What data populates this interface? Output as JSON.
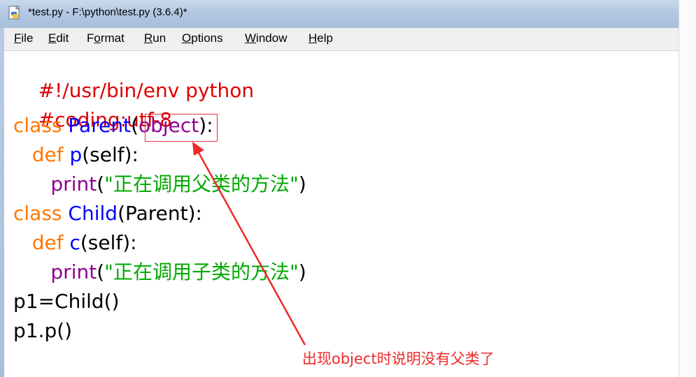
{
  "window": {
    "title": "*test.py - F:\\python\\test.py (3.6.4)*",
    "icon": "python-file-icon"
  },
  "menu": [
    {
      "accel": "F",
      "rest": "ile"
    },
    {
      "accel": "E",
      "rest": "dit"
    },
    {
      "pre": "F",
      "accel": "o",
      "rest": "rmat"
    },
    {
      "accel": "R",
      "rest": "un"
    },
    {
      "accel": "O",
      "rest": "ptions"
    },
    {
      "accel": "W",
      "rest": "indow"
    },
    {
      "accel": "H",
      "rest": "elp"
    }
  ],
  "code": {
    "line1": {
      "comment": "#!/usr/bin/env python"
    },
    "line2": {
      "comment": "#coding:utf-8"
    },
    "line3": {
      "kw": "class",
      "sp": " ",
      "name": "Parent",
      "open": "(",
      "base": "object",
      "close": "):"
    },
    "line4": {
      "indent": "   ",
      "kw": "def",
      "sp": " ",
      "name": "p",
      "args": "(self):"
    },
    "line5": {
      "indent": "      ",
      "fn": "print",
      "open": "(",
      "str": "\"正在调用父类的方法\"",
      "close": ")"
    },
    "line6": {
      "kw": "class",
      "sp": " ",
      "name": "Child",
      "args": "(Parent):"
    },
    "line7": {
      "indent": "   ",
      "kw": "def",
      "sp": " ",
      "name": "c",
      "args": "(self):"
    },
    "line8": {
      "indent": "      ",
      "fn": "print",
      "open": "(",
      "str": "\"正在调用子类的方法\"",
      "close": ")"
    },
    "line9": {
      "text": "p1=Child()"
    },
    "line10": {
      "text": "p1.p()"
    }
  },
  "annotation": {
    "text": "出现object时说明没有父类了",
    "color": "#ee2a2a"
  },
  "colors": {
    "comment": "#dd0000",
    "keyword": "#ff7700",
    "definition": "#0000ff",
    "builtin": "#900090",
    "string": "#00aa00"
  }
}
